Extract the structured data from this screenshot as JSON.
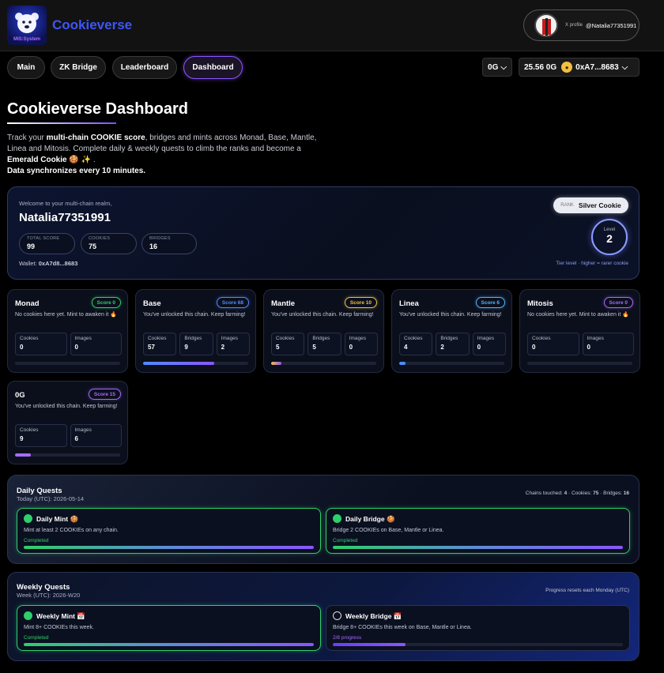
{
  "header": {
    "brand": "Cookieverse",
    "logo_text": "MIS:System",
    "x_profile_label": "X profile",
    "x_profile_user": "@Natalia77351991"
  },
  "nav": {
    "tabs": [
      {
        "label": "Main"
      },
      {
        "label": "ZK Bridge"
      },
      {
        "label": "Leaderboard"
      },
      {
        "label": "Dashboard",
        "active": true
      }
    ],
    "network": "0G",
    "balance": "25.56 0G",
    "wallet_short": "0xA7...8683",
    "coin_icon": "cookie-icon"
  },
  "page": {
    "title": "Cookieverse Dashboard",
    "desc_1": "Track your ",
    "desc_bold": "multi-chain COOKIE score",
    "desc_2": ", bridges and mints across Monad, Base, Mantle, Linea and Mitosis. Complete daily & weekly quests to climb the ranks and become a ",
    "desc_bold2": "Emerald Cookie",
    "desc_emoji": " 🍪 ✨ .",
    "desc_sync": "Data synchronizes every 10 minutes."
  },
  "welcome": {
    "subtitle": "Welcome to your multi-chain realm,",
    "name": "Natalia77351991",
    "stats": [
      {
        "label": "TOTAL SCORE",
        "value": "99"
      },
      {
        "label": "COOKIES",
        "value": "75"
      },
      {
        "label": "BRIDGES",
        "value": "16"
      }
    ],
    "wallet_label": "Wallet:",
    "wallet": "0xA7d8...8683",
    "rank_label": "RANK",
    "rank": "Silver Cookie",
    "level_label": "Level",
    "level": "2",
    "tier_note": "Tier level · higher = rarer cookie"
  },
  "chains": [
    {
      "name": "Monad",
      "score": "Score 0",
      "color": "#2ed06b",
      "desc": "No cookies here yet. Mint to awaken it 🔥",
      "stats": [
        {
          "k": "Cookies",
          "v": "0"
        },
        {
          "k": "Images",
          "v": "0"
        }
      ],
      "progress": 0,
      "bar": "#2ed06b"
    },
    {
      "name": "Base",
      "score": "Score 68",
      "color": "#4f8cff",
      "desc": "You've unlocked this chain. Keep farming!",
      "stats": [
        {
          "k": "Cookies",
          "v": "57"
        },
        {
          "k": "Bridges",
          "v": "9"
        },
        {
          "k": "Images",
          "v": "2"
        }
      ],
      "progress": 0.68,
      "bar": "linear-gradient(90deg,#4f8cff,#8b55ff)"
    },
    {
      "name": "Mantle",
      "score": "Score 10",
      "color": "#f2c041",
      "desc": "You've unlocked this chain. Keep farming!",
      "stats": [
        {
          "k": "Cookies",
          "v": "5"
        },
        {
          "k": "Bridges",
          "v": "5"
        },
        {
          "k": "Images",
          "v": "0"
        }
      ],
      "progress": 0.1,
      "bar": "linear-gradient(90deg,#f2c041,#8b55ff)"
    },
    {
      "name": "Linea",
      "score": "Score 6",
      "color": "#4fb8ff",
      "desc": "You've unlocked this chain. Keep farming!",
      "stats": [
        {
          "k": "Cookies",
          "v": "4"
        },
        {
          "k": "Bridges",
          "v": "2"
        },
        {
          "k": "Images",
          "v": "0"
        }
      ],
      "progress": 0.06,
      "bar": "#4f8cff"
    },
    {
      "name": "Mitosis",
      "score": "Score 0",
      "color": "#a86bff",
      "desc": "No cookies here yet. Mint to awaken it 🔥",
      "stats": [
        {
          "k": "Cookies",
          "v": "0"
        },
        {
          "k": "Images",
          "v": "0"
        }
      ],
      "progress": 0,
      "bar": "#a86bff"
    },
    {
      "name": "0G",
      "score": "Score 15",
      "color": "#a86bff",
      "desc": "You've unlocked this chain. Keep farming!",
      "stats": [
        {
          "k": "Cookies",
          "v": "9"
        },
        {
          "k": "Images",
          "v": "6"
        }
      ],
      "progress": 0.15,
      "bar": "#a86bff"
    }
  ],
  "daily": {
    "title": "Daily Quests",
    "sub": "Today (UTC): 2026-05-14",
    "summary_prefix": "Chains touched: ",
    "chains_touched": "4",
    "summary_mid1": " · Cookies: ",
    "cookies": "75",
    "summary_mid2": " · Bridges: ",
    "bridges": "16",
    "quests": [
      {
        "title": "Daily Mint 🍪",
        "desc": "Mint at least 2 COOKIEs on any chain.",
        "status": "Completed",
        "progress": 1,
        "done": true
      },
      {
        "title": "Daily Bridge 🍪",
        "desc": "Bridge 2 COOKIEs on Base, Mantle or Linea.",
        "status": "Completed",
        "progress": 1,
        "done": true
      }
    ]
  },
  "weekly": {
    "title": "Weekly Quests",
    "sub": "Week (UTC): 2026-W20",
    "note": "Progress resets each Monday (UTC)",
    "quests": [
      {
        "title": "Weekly Mint 📅",
        "desc": "Mint 8+ COOKIEs this week.",
        "status": "Completed",
        "progress": 1,
        "done": true
      },
      {
        "title": "Weekly Bridge 📅",
        "desc": "Bridge 8+ COOKIEs this week on Base, Mantle or Linea.",
        "status": "2/8 progress",
        "progress": 0.25,
        "done": false
      }
    ]
  }
}
